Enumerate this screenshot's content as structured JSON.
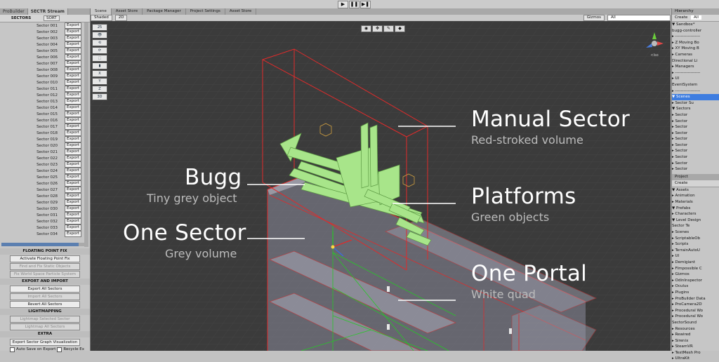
{
  "toolbar": {
    "play": "▶",
    "pause": "❚❚",
    "step": "▶❚"
  },
  "left_panel": {
    "tabs": [
      "ProBuilder",
      "SECTR Stream"
    ],
    "sectors_header": "SECTORS",
    "sort_label": "SORT",
    "sectors": [
      "Sector 001",
      "Sector 002",
      "Sector 003",
      "Sector 004",
      "Sector 005",
      "Sector 006",
      "Sector 007",
      "Sector 008",
      "Sector 009",
      "Sector 010",
      "Sector 011",
      "Sector 012",
      "Sector 013",
      "Sector 014",
      "Sector 015",
      "Sector 016",
      "Sector 017",
      "Sector 018",
      "Sector 019",
      "Sector 020",
      "Sector 021",
      "Sector 022",
      "Sector 023",
      "Sector 024",
      "Sector 025",
      "Sector 026",
      "Sector 027",
      "Sector 028",
      "Sector 029",
      "Sector 030",
      "Sector 031",
      "Sector 032",
      "Sector 033",
      "Sector 034"
    ],
    "export_label": "Export",
    "sections": [
      {
        "title": "FLOATING POINT FIX",
        "buttons": [
          {
            "label": "Activate Floating Point Fix",
            "dim": false
          },
          {
            "label": "Find and Fix Static Objects",
            "dim": true
          },
          {
            "label": "Fix World Space Particle System",
            "dim": true
          }
        ]
      },
      {
        "title": "EXPORT AND IMPORT",
        "buttons": [
          {
            "label": "Export All Sectors",
            "dim": false
          },
          {
            "label": "Import All Sectors",
            "dim": true
          },
          {
            "label": "Revert All Sectors",
            "dim": false
          }
        ]
      },
      {
        "title": "LIGHTMAPPING",
        "buttons": [
          {
            "label": "Lightmap Selected Sector",
            "dim": true
          },
          {
            "label": "Lightmap All Sectors",
            "dim": true
          }
        ]
      },
      {
        "title": "EXTRA",
        "buttons": []
      }
    ],
    "footer_button": "Export Sector Graph Visualization",
    "checks": [
      "Auto Save on Export",
      "Recycle Ex"
    ]
  },
  "scene": {
    "tabs": [
      "Scene",
      "Asset Store",
      "Package Manager",
      "Project Settings",
      "Asset Store"
    ],
    "tb_shaded": "Shaded",
    "tb_2d": "2D",
    "tb_gizmos": "Gizmos",
    "tb_search": "All",
    "left_icons": [
      "25",
      "👁",
      "⟲",
      "⟳",
      "⬚",
      "▮",
      "X",
      "Y",
      "Z",
      "3D"
    ],
    "annotations": [
      {
        "id": "manual",
        "title": "Manual Sector",
        "sub": "Red-stroked volume"
      },
      {
        "id": "bugg",
        "title": "Bugg",
        "sub": "Tiny grey object"
      },
      {
        "id": "platforms",
        "title": "Platforms",
        "sub": "Green objects"
      },
      {
        "id": "onesector",
        "title": "One Sector",
        "sub": "Grey volume"
      },
      {
        "id": "portal",
        "title": "One Portal",
        "sub": "White quad"
      }
    ],
    "colors": {
      "bg": "#3b3b3b",
      "sector_stroke": "#e02b2b",
      "platform": "#a8e58a",
      "annotation": "#ffffff"
    }
  },
  "hierarchy": {
    "tab": "Hierarchy",
    "create": "Create",
    "search": "All",
    "items": [
      {
        "t": "▼ Sandbox*",
        "sel": false
      },
      {
        "t": "   bugg-controller",
        "sel": false
      },
      {
        "t": "  ▸ ------------------",
        "sel": false
      },
      {
        "t": "  ▸ Z Moving Bo",
        "sel": false
      },
      {
        "t": "  ▸ XY Moving B",
        "sel": false
      },
      {
        "t": "  ▸ Cameras",
        "sel": false
      },
      {
        "t": "    Directional Li",
        "sel": false
      },
      {
        "t": "  ▸ Managers",
        "sel": false
      },
      {
        "t": "  ▸ ------------------",
        "sel": false
      },
      {
        "t": "  ▸ UI",
        "sel": false
      },
      {
        "t": "    EventSystem",
        "sel": false
      },
      {
        "t": "  ▸ ------------------",
        "sel": false
      },
      {
        "t": "  ▼ Scenes",
        "sel": true
      },
      {
        "t": "    ▸ Sector Su",
        "sel": false
      },
      {
        "t": "    ▼ Sectors",
        "sel": false
      },
      {
        "t": "      ▸ Sector",
        "sel": false
      },
      {
        "t": "      ▸ Sector",
        "sel": false
      },
      {
        "t": "      ▸ Sector",
        "sel": false
      },
      {
        "t": "      ▸ Sector",
        "sel": false
      },
      {
        "t": "      ▸ Sector",
        "sel": false
      },
      {
        "t": "      ▸ Sector",
        "sel": false
      },
      {
        "t": "      ▸ Sector",
        "sel": false
      },
      {
        "t": "      ▸ Sector",
        "sel": false
      },
      {
        "t": "      ▸ Sector",
        "sel": false
      },
      {
        "t": "      ▸ Sector",
        "sel": false
      }
    ]
  },
  "project": {
    "tab": "Project",
    "create": "Create",
    "items": [
      "▼ Assets",
      "  ▸ Animation",
      "  ▸ Materials",
      "  ▼ Prefabs",
      "    ▸ Characters",
      "    ▼ Level Design",
      "      Sector Te",
      "  ▸ Scenes",
      "  ▸ ScriptableOb",
      "  ▸ Scripts",
      "  ▸ TerrainAutoU",
      "  ▸ UI",
      "  ▸ Demigiant",
      "  ▸ FImpossible C",
      "  ▸ Gizmos",
      "  ▸ OdinInspector",
      "  ▸ Oculus",
      "  ▸ Plugins",
      "  ▸ ProBuilder Data",
      "  ▸ ProCamera2D",
      "  ▸ Procedural Wo",
      "  ▸ Procedural Wo",
      "    SectorSound",
      "  ▸ Resources",
      "  ▸ Rewired",
      "  ▸ Sirenix",
      "  ▸ SteamVR",
      "  ▸ TextMesh Pro",
      "  ▸ UltraKit"
    ]
  }
}
